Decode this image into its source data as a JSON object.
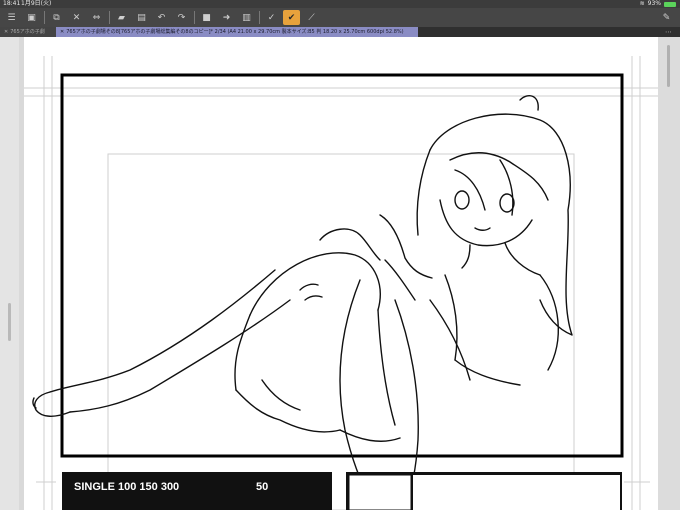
{
  "status_bar": {
    "time": "18:41",
    "date": "1月9日(火)",
    "battery": "93%"
  },
  "toolbar": {
    "buttons": [
      {
        "name": "menu-icon",
        "glyph": "☰"
      },
      {
        "name": "settings-icon",
        "glyph": "▣"
      },
      {
        "name": "fit-icon",
        "glyph": "⧉"
      },
      {
        "name": "transform-icon",
        "glyph": "✕"
      },
      {
        "name": "flip-icon",
        "glyph": "⇔"
      },
      {
        "name": "open-icon",
        "glyph": "▰"
      },
      {
        "name": "save-icon",
        "glyph": "▤"
      },
      {
        "name": "undo-icon",
        "glyph": "↶"
      },
      {
        "name": "redo-icon",
        "glyph": "↷"
      },
      {
        "name": "fill-icon",
        "glyph": "■"
      },
      {
        "name": "brush-icon",
        "glyph": "➜"
      },
      {
        "name": "layer-icon",
        "glyph": "▥"
      },
      {
        "name": "check-icon",
        "glyph": "✓"
      },
      {
        "name": "snap-icon",
        "glyph": "✔"
      },
      {
        "name": "ruler-icon",
        "glyph": "⟋"
      }
    ],
    "right_buttons": [
      {
        "name": "pen-icon",
        "glyph": "✎"
      }
    ]
  },
  "tabs": [
    {
      "label": "765アホの子劇"
    },
    {
      "label": "765アホの子劇場その8[765アホの子劇場総集編その8のコピー]* 2/34 (A4 21.00 x 29.70cm 製本サイズ:B5 判 18.20 x 25.70cm 600dpi 52.8%)"
    }
  ],
  "tab_menu_glyph": "⋯",
  "page": {
    "caption_left": "SINGLE 100 150 300",
    "caption_number": "50"
  },
  "colors": {
    "accent": "#e8a23c",
    "tab_active": "#8a8cc4",
    "toolbar": "#464646"
  }
}
